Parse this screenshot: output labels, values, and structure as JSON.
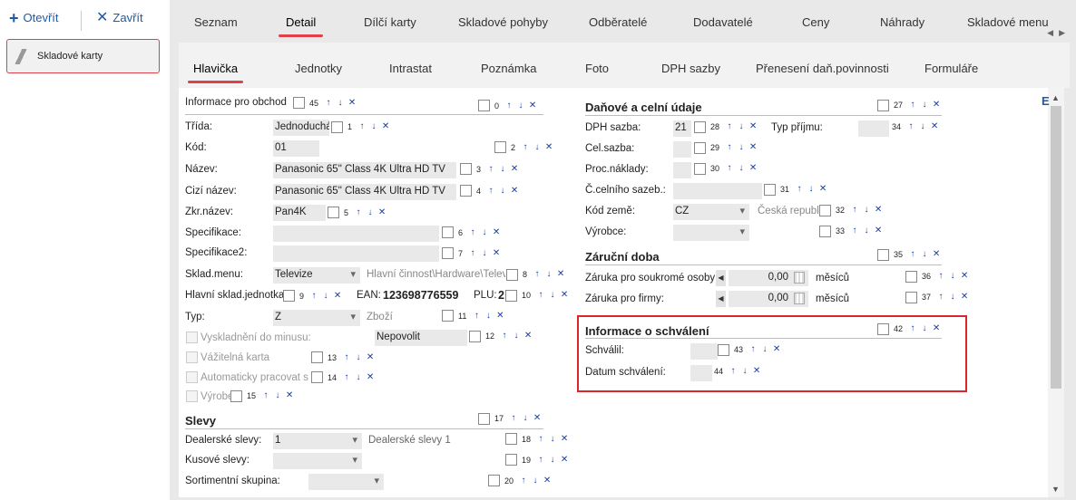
{
  "toolbar": {
    "open_label": "Otevřít",
    "close_label": "Zavřít"
  },
  "nav": {
    "item_label": "Skladové karty"
  },
  "tabs": [
    "Seznam",
    "Detail",
    "Dílčí karty",
    "Skladové pohyby",
    "Odběratelé",
    "Dodavatelé",
    "Ceny",
    "Náhrady",
    "Skladové menu"
  ],
  "subtabs": [
    "Hlavička",
    "Jednotky",
    "Intrastat",
    "Poznámka",
    "Foto",
    "DPH sazby",
    "Přenesení daň.povinnosti",
    "Formuláře"
  ],
  "left": {
    "header_label": "Informace pro obchod",
    "header_num": "45",
    "header_num2": "0",
    "trida": {
      "label": "Třída:",
      "value": "Jednoduchá",
      "num": "1"
    },
    "kod": {
      "label": "Kód:",
      "value": "01",
      "num": "2"
    },
    "nazev": {
      "label": "Název:",
      "value": "Panasonic 65\" Class 4K Ultra HD TV",
      "num": "3"
    },
    "cizi": {
      "label": "Cizí název:",
      "value": "Panasonic 65\" Class 4K Ultra HD TV",
      "num": "4"
    },
    "zkr": {
      "label": "Zkr.název:",
      "value": "Pan4K",
      "num": "5"
    },
    "spec": {
      "label": "Specifikace:",
      "value": "",
      "num": "6"
    },
    "spec2": {
      "label": "Specifikace2:",
      "value": "",
      "num": "7"
    },
    "sklad": {
      "label": "Sklad.menu:",
      "value": "Televize",
      "path": "Hlavní činnost\\Hardware\\Televiz",
      "num": "8"
    },
    "hlavni": {
      "label": "Hlavní sklad.jednotka:",
      "num": "9",
      "ean_label": "EAN:",
      "ean_value": "123698776559",
      "plu_label": "PLU:",
      "plu_value": "2",
      "num2": "10"
    },
    "typ": {
      "label": "Typ:",
      "value": "Z",
      "value2": "Zboží",
      "num": "11"
    },
    "vysk": {
      "label": "Vyskladnění do minusu:",
      "value": "Nepovolit",
      "num": "12"
    },
    "vazit": {
      "label": "Vážitelná karta",
      "num": "13"
    },
    "auto": {
      "label": "Automaticky pracovat s d",
      "num": "14"
    },
    "vyrobe": {
      "label": "Výrobe",
      "num": "15"
    },
    "slevy": {
      "title": "Slevy",
      "num": "17"
    },
    "dealer": {
      "label": "Dealerské slevy:",
      "value": "1",
      "value2": "Dealerské slevy 1",
      "num": "18"
    },
    "kusove": {
      "label": "Kusové slevy:",
      "value": "",
      "num": "19"
    },
    "sortiment": {
      "label": "Sortimentní skupina:",
      "value": "",
      "num": "20"
    }
  },
  "right": {
    "dan": {
      "title": "Daňové a celní údaje",
      "num": "27"
    },
    "dph": {
      "label": "DPH sazba:",
      "value": "21",
      "num": "28",
      "typ_label": "Typ příjmu:",
      "num2": "34"
    },
    "cel": {
      "label": "Cel.sazba:",
      "num": "29"
    },
    "proc": {
      "label": "Proc.náklady:",
      "num": "30"
    },
    "ccs": {
      "label": "Č.celního sazeb.:",
      "num": "31"
    },
    "kodzeme": {
      "label": "Kód země:",
      "value": "CZ",
      "value2": "Česká republik",
      "num": "32"
    },
    "vyrobce": {
      "label": "Výrobce:",
      "num": "33"
    },
    "zaruka": {
      "title": "Záruční doba",
      "num": "35"
    },
    "zar1": {
      "label": "Záruka pro soukromé osoby:",
      "value": "0,00",
      "unit": "měsíců",
      "num": "36"
    },
    "zar2": {
      "label": "Záruka pro firmy:",
      "value": "0,00",
      "unit": "měsíců",
      "num": "37"
    },
    "schval": {
      "title": "Informace o schválení",
      "num": "42"
    },
    "schvalil": {
      "label": "Schválil:",
      "num": "43"
    },
    "datum": {
      "label": "Datum schválení:",
      "num": "44"
    }
  },
  "colors": {
    "accent": "#e0404a",
    "link": "#1e5aa8",
    "highlight": "#d9262c"
  }
}
